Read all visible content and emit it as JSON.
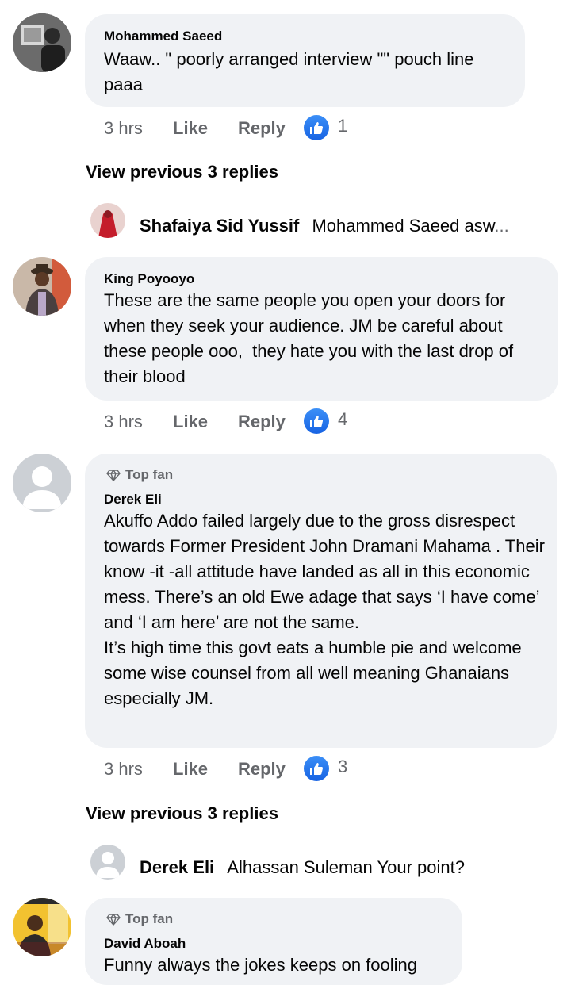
{
  "comments": [
    {
      "author": "Mohammed Saeed",
      "text": "Waaw.. \" poorly arranged interview \"\" pouch line paaa",
      "time": "3 hrs",
      "like": "Like",
      "reply": "Reply",
      "reactions": "1"
    },
    {
      "author": "King Poyooyo",
      "text": "These are the same people you open your doors for when they seek your audience. JM be careful about these people ooo,  they hate you with the last drop of their blood",
      "time": "3 hrs",
      "like": "Like",
      "reply": "Reply",
      "reactions": "4"
    },
    {
      "badge": "Top fan",
      "author": "Derek Eli",
      "text": "Akuffo Addo failed largely due to the gross disrespect towards Former President John Dramani Mahama . Their know -it -all attitude have landed as all in this economic mess. There’s an old Ewe adage that says ‘I have come’ and ‘I am here’ are not the same.\nIt’s high time this govt eats a humble pie and welcome some wise counsel from all well meaning Ghanaians especially JM.",
      "time": "3 hrs",
      "like": "Like",
      "reply": "Reply",
      "reactions": "3"
    },
    {
      "badge": "Top fan",
      "author": "David Aboah",
      "text": "Funny always the jokes keeps on fooling"
    }
  ],
  "view_previous": [
    "View previous 3 replies",
    "View previous 3 replies"
  ],
  "reply_previews": [
    {
      "author": "Shafaiya Sid Yussif",
      "text": "Mohammed Saeed asw",
      "ellipsis": "..."
    },
    {
      "author": "Derek Eli",
      "text": "Alhassan Suleman  Your point?"
    }
  ],
  "colors": {
    "bubble": "#f0f2f5",
    "like_blue": "#1877f2",
    "meta_gray": "#65676b"
  }
}
